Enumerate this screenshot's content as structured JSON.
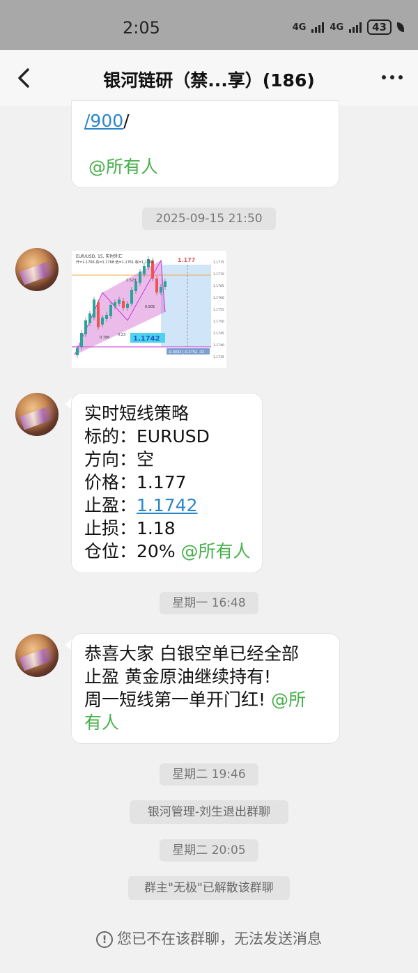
{
  "status_bar": {
    "time": "2:05",
    "network1": "4G",
    "network2": "4G",
    "battery": "43"
  },
  "header": {
    "title": "银河链研（禁...享）(186)"
  },
  "messages": {
    "partial": {
      "link": "/900",
      "slash": "/",
      "mention": "@所有人"
    },
    "time1": "2025-09-15 21:50",
    "chart": {
      "pair_label": "EUR/USD, 15, 实时外汇",
      "ohlc": "开=1.1766  高=1.1768  低=1.1761  收=1.1762",
      "price_tag": "1.177",
      "target_tag": "1.1742",
      "range_tag": "-0.0032 (-0.27%) -32",
      "ratio1": "2.523",
      "ratio2": "0.905",
      "ratio3": "0.786",
      "ratio4": "0.23",
      "axis": [
        "1.1775",
        "1.1770",
        "1.1765",
        "1.1760",
        "1.1755",
        "1.1750",
        "1.1745",
        "1.1740",
        "1.1735"
      ],
      "colors": {
        "up": "#26a69a",
        "down": "#ef5350",
        "pattern": "#d36bd1",
        "zone": "#bcdcf5"
      }
    },
    "strategy": {
      "lines": [
        {
          "text": "实时短线策略"
        },
        {
          "label": "标的：",
          "value": "EURUSD"
        },
        {
          "label": "方向：",
          "value": "空"
        },
        {
          "label": "价格：",
          "value": "1.177"
        },
        {
          "label": "止盈：",
          "value": "1.1742"
        },
        {
          "label": "止损：",
          "value": "1.18"
        },
        {
          "label": "仓位：",
          "value": "20%",
          "mention": "@所有人"
        }
      ]
    },
    "time2": "星期一 16:48",
    "congrats": {
      "line1": "恭喜大家   白银空单已经全部",
      "line2": "止盈        黄金原油继续持有!",
      "line3": "周一短线第一单开门红!",
      "mention_a": "@所",
      "line4": "有人"
    },
    "time3": "星期二 19:46",
    "system1": "银河管理-刘生退出群聊",
    "time4": "星期二 20:05",
    "system2": "群主\"无极\"已解散该群聊"
  },
  "footer": {
    "notice": "您已不在该群聊，无法发送消息"
  }
}
